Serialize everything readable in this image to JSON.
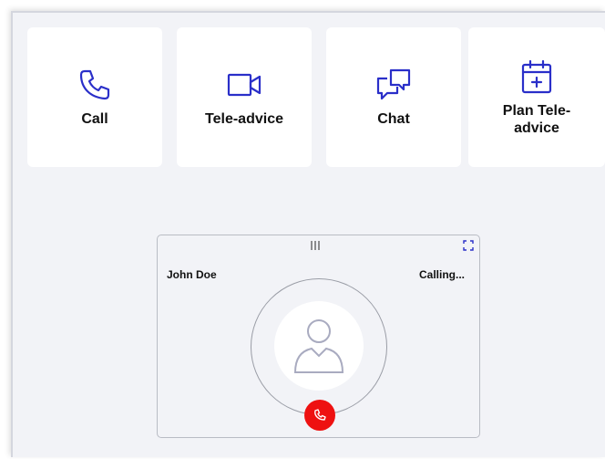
{
  "actions": {
    "call": {
      "label": "Call",
      "icon": "phone-icon"
    },
    "tele_advice": {
      "label": "Tele-advice",
      "icon": "video-camera-icon"
    },
    "chat": {
      "label": "Chat",
      "icon": "chat-bubbles-icon"
    },
    "plan_tele_advice": {
      "label": "Plan Tele-advice",
      "icon": "calendar-plus-icon"
    }
  },
  "call_widget": {
    "caller_name": "John Doe",
    "status": "Calling...",
    "avatar_icon": "user-avatar-icon",
    "drag_icon": "drag-handle-icon",
    "expand_icon": "expand-icon",
    "hangup_icon": "hangup-icon"
  },
  "colors": {
    "accent": "#2a2fc9",
    "hangup": "#ee1111",
    "background": "#f2f3f7",
    "tile": "#ffffff"
  }
}
